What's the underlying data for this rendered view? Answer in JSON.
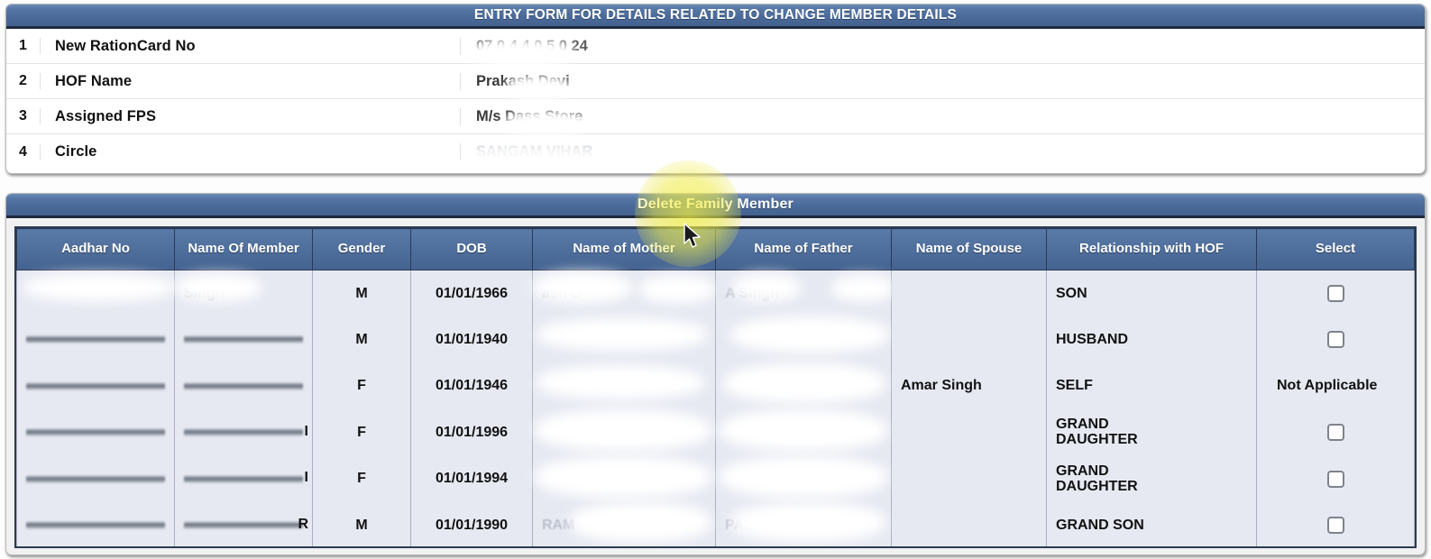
{
  "form": {
    "title": "ENTRY FORM FOR DETAILS RELATED TO CHANGE MEMBER DETAILS",
    "rows": [
      {
        "index": "1",
        "label": "New RationCard No",
        "value": "07 0 4 4 0 5 0 24",
        "redacted": true
      },
      {
        "index": "2",
        "label": "HOF Name",
        "value": "Prakash Devi",
        "redacted": true
      },
      {
        "index": "3",
        "label": "Assigned FPS",
        "value": "M/s Dass Store",
        "redacted": true
      },
      {
        "index": "4",
        "label": "Circle",
        "value": "SANGAM VIHAR",
        "redacted": true
      }
    ]
  },
  "members": {
    "title": "Delete Family Member",
    "columns": [
      "Aadhar No",
      "Name Of Member",
      "Gender",
      "DOB",
      "Name of Mother",
      "Name of Father",
      "Name of Spouse",
      "Relationship with HOF",
      "Select"
    ],
    "rows": [
      {
        "aadhar": "",
        "aadhar_redacted": true,
        "name": "Singh",
        "name_redacted": true,
        "gender": "M",
        "dob": "01/01/1966",
        "mother": "ash D",
        "mother_redacted": true,
        "father": "A Singh",
        "father_redacted": true,
        "spouse": "",
        "relationship": "SON",
        "select_type": "checkbox",
        "select_checked": false,
        "select_label": ""
      },
      {
        "aadhar": "",
        "aadhar_redacted": true,
        "name": "",
        "name_redacted": true,
        "gender": "M",
        "dob": "01/01/1940",
        "mother": "",
        "mother_redacted": true,
        "father": "",
        "father_redacted": true,
        "spouse": "",
        "relationship": "HUSBAND",
        "select_type": "checkbox",
        "select_checked": false,
        "select_label": ""
      },
      {
        "aadhar": "",
        "aadhar_redacted": true,
        "name": "",
        "name_redacted": true,
        "gender": "F",
        "dob": "01/01/1946",
        "mother": "",
        "mother_redacted": true,
        "father": "",
        "father_redacted": true,
        "spouse": "Amar Singh",
        "relationship": "SELF",
        "select_type": "text",
        "select_checked": false,
        "select_label": "Not Applicable"
      },
      {
        "aadhar": "",
        "aadhar_redacted": true,
        "name": "I",
        "name_redacted": true,
        "gender": "F",
        "dob": "01/01/1996",
        "mother": "",
        "mother_redacted": true,
        "father": "",
        "father_redacted": true,
        "spouse": "",
        "relationship": "GRAND DAUGHTER",
        "select_type": "checkbox",
        "select_checked": false,
        "select_label": ""
      },
      {
        "aadhar": "",
        "aadhar_redacted": true,
        "name": "I",
        "name_redacted": true,
        "gender": "F",
        "dob": "01/01/1994",
        "mother": "",
        "mother_redacted": true,
        "father": "",
        "father_redacted": true,
        "spouse": "",
        "relationship": "GRAND DAUGHTER",
        "select_type": "checkbox",
        "select_checked": false,
        "select_label": ""
      },
      {
        "aadhar": "",
        "aadhar_redacted": true,
        "name": "R",
        "name_redacted": true,
        "gender": "M",
        "dob": "01/01/1990",
        "mother": "RAM",
        "mother_redacted": true,
        "father": "PAL",
        "father_redacted": true,
        "spouse": "",
        "relationship": "GRAND SON",
        "select_type": "checkbox",
        "select_checked": false,
        "select_label": ""
      }
    ]
  },
  "colors": {
    "header_blue": "#4a6a9a",
    "table_header_blue": "#4e6e9c",
    "row_bg": "#e6e9f2",
    "border_dark": "#2b3a52",
    "spotlight_yellow": "#f0eb46"
  },
  "pointer": {
    "cursor_icon": "arrow-cursor",
    "highlight_icon": "click-spotlight"
  }
}
